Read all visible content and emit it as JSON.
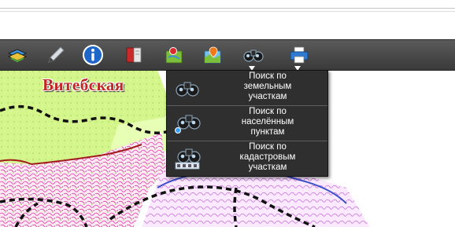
{
  "map": {
    "region_label": "Витебская"
  },
  "toolbar": {
    "items": [
      {
        "icon": "layers-stack-icon"
      },
      {
        "icon": "pencil-icon"
      },
      {
        "icon": "info-icon"
      },
      {
        "icon": "book-icon"
      },
      {
        "icon": "map-pin-icon"
      },
      {
        "icon": "map-marker-icon"
      },
      {
        "icon": "binoculars-icon"
      },
      {
        "icon": "printer-icon"
      }
    ]
  },
  "search_menu": {
    "items": [
      {
        "label": "Поиск по\nземельным\nучасткам",
        "icon": "binoculars-icon"
      },
      {
        "label": "Поиск по\nнаселённым\nпунктам",
        "icon": "binoculars-location-icon"
      },
      {
        "label": "Поиск по\nкадастровым\nучасткам",
        "icon": "binoculars-ab-icon"
      }
    ]
  },
  "colors": {
    "toolbar_bg": "#444444",
    "menu_bg": "#2f2f2f",
    "region_label": "#c02828",
    "forest_green": "#c8f080",
    "boundary_blue": "#3b4fc9",
    "boundary_red": "#a31c1c"
  }
}
